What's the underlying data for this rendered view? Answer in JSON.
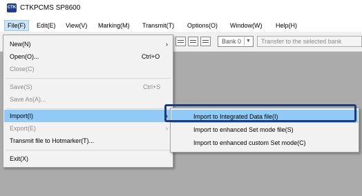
{
  "window": {
    "title": "CTKPCMS SP8600",
    "icon": "ctk-logo-icon",
    "icon_text": "CTK"
  },
  "menubar": {
    "items": [
      "File(F)",
      "Edit(E)",
      "View(V)",
      "Marking(M)",
      "Transmit(T)",
      "Options(O)",
      "Window(W)",
      "Help(H)"
    ],
    "active": "File(F)"
  },
  "toolbar": {
    "bank_value": "Bank  0",
    "transfer_label": "Transfer to the selected bank"
  },
  "file_menu": {
    "new": {
      "label": "New(N)",
      "has_submenu": true
    },
    "open": {
      "label": "Open(O)...",
      "shortcut": "Ctrl+O"
    },
    "close": {
      "label": "Close(C)",
      "disabled": true
    },
    "save": {
      "label": "Save(S)",
      "shortcut": "Ctrl+S",
      "disabled": true
    },
    "save_as": {
      "label": "Save As(A)...",
      "disabled": true
    },
    "import": {
      "label": "Import(I)",
      "has_submenu": true,
      "selected": true
    },
    "export": {
      "label": "Export(E)",
      "has_submenu": true,
      "disabled": true
    },
    "transmit_file": {
      "label": "Transmit file to Hotmarker(T)..."
    },
    "exit": {
      "label": "Exit(X)"
    }
  },
  "import_submenu": {
    "items": [
      "Import to Integrated Data file(I)",
      "Import to enhanced Set mode file(S)",
      "Import to enhanced custom Set mode(C)"
    ],
    "hovered": "Import to Integrated Data file(I)"
  },
  "colors": {
    "menu_selection": "#91c9f7",
    "highlight_border": "#1f3c7a",
    "workspace": "#ababab"
  }
}
